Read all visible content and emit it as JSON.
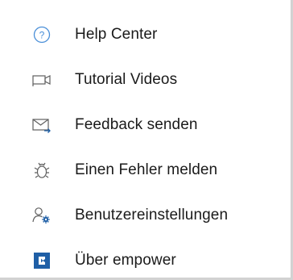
{
  "menu": {
    "items": [
      {
        "label": "Help Center",
        "icon": "help-circle-icon"
      },
      {
        "label": "Tutorial Videos",
        "icon": "video-camera-icon"
      },
      {
        "label": "Feedback senden",
        "icon": "envelope-send-icon"
      },
      {
        "label": "Einen Fehler melden",
        "icon": "bug-icon"
      },
      {
        "label": "Benutzereinstellungen",
        "icon": "user-settings-icon"
      },
      {
        "label": "Über empower",
        "icon": "empower-logo-icon"
      }
    ]
  },
  "colors": {
    "icon_gray": "#5f5f5f",
    "help_blue": "#4a8fd8",
    "accent_blue": "#1f5fa6",
    "text": "#1a1a1a"
  }
}
